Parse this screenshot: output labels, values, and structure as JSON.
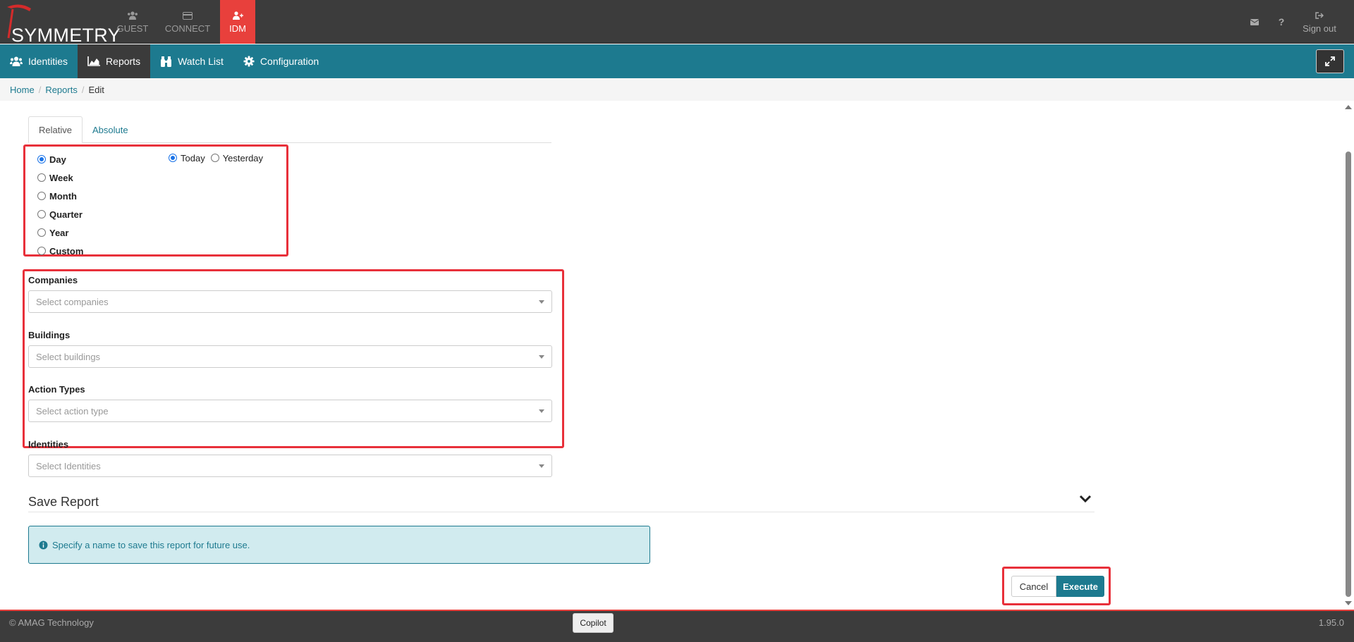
{
  "brand": {
    "name": "SYMMETRY",
    "tm": "™"
  },
  "topnav": {
    "guest": "GUEST",
    "connect": "CONNECT",
    "idm": "IDM"
  },
  "topright": {
    "signout": "Sign out"
  },
  "modnav": {
    "identities": "Identities",
    "reports": "Reports",
    "watchlist": "Watch List",
    "configuration": "Configuration"
  },
  "breadcrumb": {
    "home": "Home",
    "reports": "Reports",
    "current": "Edit"
  },
  "tabs": {
    "relative": "Relative",
    "absolute": "Absolute"
  },
  "period": {
    "options": [
      "Day",
      "Week",
      "Month",
      "Quarter",
      "Year",
      "Custom"
    ],
    "selected": "Day",
    "sub_options": [
      "Today",
      "Yesterday"
    ],
    "sub_selected": "Today"
  },
  "filters": {
    "companies": {
      "label": "Companies",
      "placeholder": "Select companies"
    },
    "buildings": {
      "label": "Buildings",
      "placeholder": "Select buildings"
    },
    "action_types": {
      "label": "Action Types",
      "placeholder": "Select action type"
    },
    "identities": {
      "label": "Identities",
      "placeholder": "Select Identities"
    }
  },
  "save": {
    "title": "Save Report",
    "info": "Specify a name to save this report for future use."
  },
  "actions": {
    "cancel": "Cancel",
    "execute": "Execute"
  },
  "footer": {
    "copyright": "© AMAG Technology",
    "copilot": "Copilot",
    "version": "1.95.0"
  },
  "colors": {
    "accent": "#1d7a8f",
    "brand_red": "#e8403c",
    "highlight": "#e8303a",
    "dark": "#3c3c3c"
  }
}
